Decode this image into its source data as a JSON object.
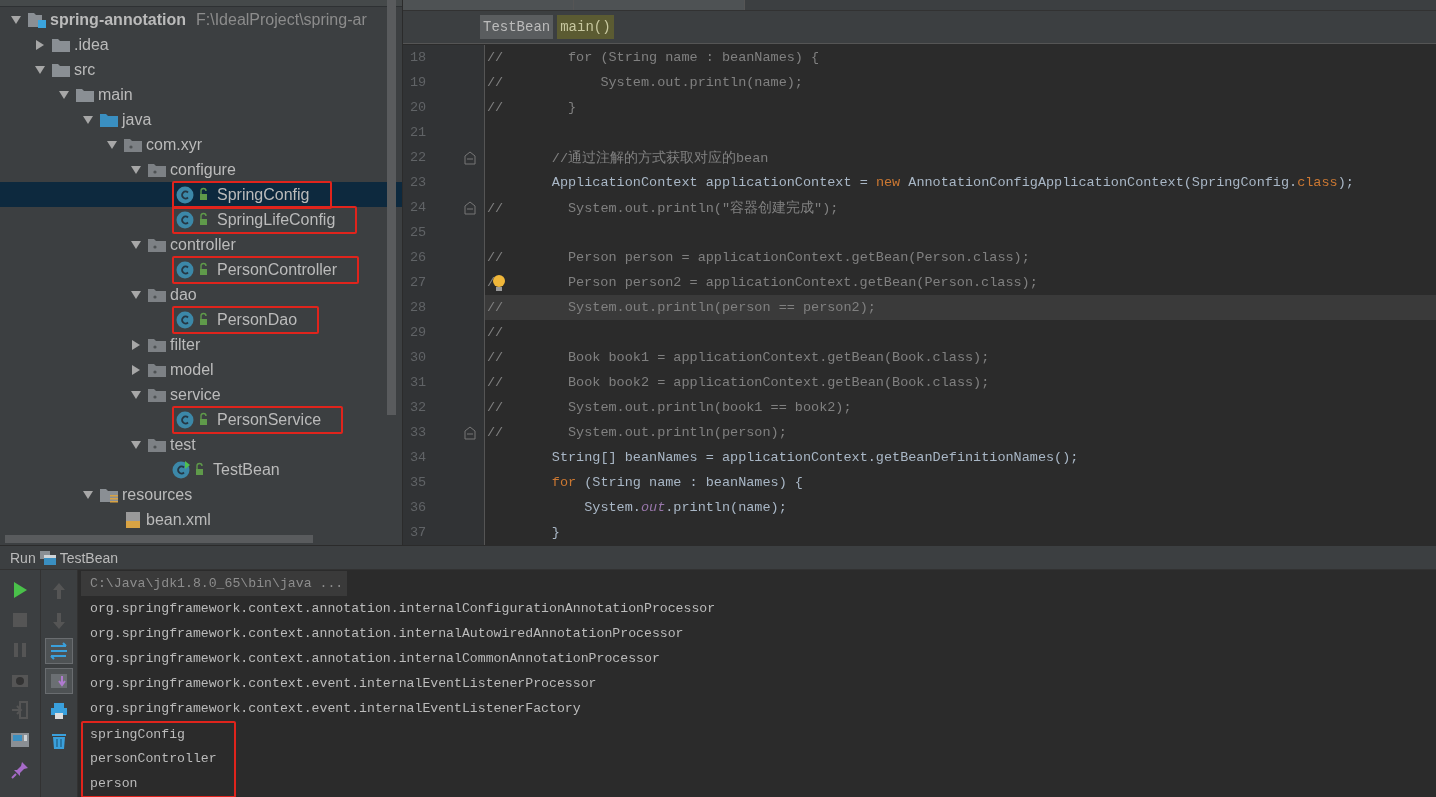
{
  "project_tree": {
    "items": [
      {
        "label": "spring-annotation",
        "kind": "project",
        "path": "F:\\IdealProject\\spring-ar",
        "expanded": true,
        "selected": false,
        "boxed": false,
        "children": [
          {
            "label": ".idea",
            "kind": "folder",
            "expanded": false,
            "selected": false,
            "boxed": false
          },
          {
            "label": "src",
            "kind": "folder",
            "expanded": true,
            "selected": false,
            "boxed": false,
            "children": [
              {
                "label": "main",
                "kind": "folder",
                "expanded": true,
                "selected": false,
                "boxed": false,
                "children": [
                  {
                    "label": "java",
                    "kind": "source",
                    "expanded": true,
                    "selected": false,
                    "boxed": false,
                    "children": [
                      {
                        "label": "com.xyr",
                        "kind": "package",
                        "expanded": true,
                        "selected": false,
                        "boxed": false,
                        "children": [
                          {
                            "label": "configure",
                            "kind": "package",
                            "expanded": true,
                            "selected": false,
                            "boxed": false,
                            "children": [
                              {
                                "label": "SpringConfig",
                                "kind": "class",
                                "selected": true,
                                "boxed": true
                              },
                              {
                                "label": "SpringLifeConfig",
                                "kind": "class",
                                "selected": false,
                                "boxed": true
                              }
                            ]
                          },
                          {
                            "label": "controller",
                            "kind": "package",
                            "expanded": true,
                            "selected": false,
                            "boxed": false,
                            "children": [
                              {
                                "label": "PersonController",
                                "kind": "class",
                                "selected": false,
                                "boxed": true
                              }
                            ]
                          },
                          {
                            "label": "dao",
                            "kind": "package",
                            "expanded": true,
                            "selected": false,
                            "boxed": false,
                            "children": [
                              {
                                "label": "PersonDao",
                                "kind": "class",
                                "selected": false,
                                "boxed": true
                              }
                            ]
                          },
                          {
                            "label": "filter",
                            "kind": "package",
                            "expanded": false,
                            "selected": false,
                            "boxed": false
                          },
                          {
                            "label": "model",
                            "kind": "package",
                            "expanded": false,
                            "selected": false,
                            "boxed": false
                          },
                          {
                            "label": "service",
                            "kind": "package",
                            "expanded": true,
                            "selected": false,
                            "boxed": false,
                            "children": [
                              {
                                "label": "PersonService",
                                "kind": "class",
                                "selected": false,
                                "boxed": true
                              }
                            ]
                          },
                          {
                            "label": "test",
                            "kind": "package",
                            "expanded": true,
                            "selected": false,
                            "boxed": false,
                            "children": [
                              {
                                "label": "TestBean",
                                "kind": "runnable",
                                "selected": false,
                                "boxed": false
                              }
                            ]
                          }
                        ]
                      }
                    ]
                  },
                  {
                    "label": "resources",
                    "kind": "resources",
                    "expanded": true,
                    "selected": false,
                    "boxed": false,
                    "children": [
                      {
                        "label": "bean.xml",
                        "kind": "xml",
                        "selected": false,
                        "boxed": false
                      }
                    ]
                  }
                ]
              }
            ]
          }
        ]
      }
    ]
  },
  "editor": {
    "breadcrumbs": [
      {
        "label": "TestBean",
        "selected": false
      },
      {
        "label": "main()",
        "selected": true
      }
    ],
    "lines": [
      {
        "number": "18",
        "current": false,
        "segments": [
          {
            "text": "//        for (String name : beanNames) {",
            "kind": "comment"
          }
        ]
      },
      {
        "number": "19",
        "current": false,
        "segments": [
          {
            "text": "//            System.out.println(name);",
            "kind": "comment"
          }
        ]
      },
      {
        "number": "20",
        "current": false,
        "segments": [
          {
            "text": "//        }",
            "kind": "comment"
          }
        ]
      },
      {
        "number": "21",
        "current": false
      },
      {
        "number": "22",
        "current": false,
        "fold_marker": true,
        "segments": [
          {
            "text": "        //通过注解的方式获取对应的bean",
            "kind": "comment"
          }
        ]
      },
      {
        "number": "23",
        "current": false,
        "segments": [
          {
            "text": "        ApplicationContext applicationContext = ",
            "kind": "plain"
          },
          {
            "text": "new",
            "kind": "keyword"
          },
          {
            "text": " AnnotationConfigApplicationContext(SpringConfig.",
            "kind": "plain"
          },
          {
            "text": "class",
            "kind": "keyword"
          },
          {
            "text": ");",
            "kind": "plain"
          }
        ]
      },
      {
        "number": "24",
        "current": false,
        "fold_marker": true,
        "segments": [
          {
            "text": "//        System.out.println(\"容器创建完成\");",
            "kind": "comment"
          }
        ]
      },
      {
        "number": "25",
        "current": false
      },
      {
        "number": "26",
        "current": false,
        "segments": [
          {
            "text": "//        Person person = applicationContext.getBean(Person.class);",
            "kind": "comment"
          }
        ]
      },
      {
        "number": "27",
        "current": false,
        "segments": [
          {
            "text": "/",
            "kind": "comment"
          },
          {
            "kind": "bulb"
          },
          {
            "text": "        Person person2 = applicationContext.getBean(Person.class);",
            "kind": "comment"
          }
        ]
      },
      {
        "number": "28",
        "current": true,
        "segments": [
          {
            "text": "//        System.out.println(person == person2);",
            "kind": "comment"
          }
        ]
      },
      {
        "number": "29",
        "current": false,
        "segments": [
          {
            "text": "//",
            "kind": "comment"
          }
        ]
      },
      {
        "number": "30",
        "current": false,
        "segments": [
          {
            "text": "//        Book book1 = applicationContext.getBean(Book.class);",
            "kind": "comment"
          }
        ]
      },
      {
        "number": "31",
        "current": false,
        "segments": [
          {
            "text": "//        Book book2 = applicationContext.getBean(Book.class);",
            "kind": "comment"
          }
        ]
      },
      {
        "number": "32",
        "current": false,
        "segments": [
          {
            "text": "//        System.out.println(book1 == book2);",
            "kind": "comment"
          }
        ]
      },
      {
        "number": "33",
        "current": false,
        "fold_marker": true,
        "segments": [
          {
            "text": "//        System.out.println(person);",
            "kind": "comment"
          }
        ]
      },
      {
        "number": "34",
        "current": false,
        "segments": [
          {
            "text": "        String[] beanNames = applicationContext.getBeanDefinitionNames();",
            "kind": "plain"
          }
        ]
      },
      {
        "number": "35",
        "current": false,
        "segments": [
          {
            "text": "        for",
            "kind": "keyword"
          },
          {
            "text": " (String name : beanNames) {",
            "kind": "plain"
          }
        ]
      },
      {
        "number": "36",
        "current": false,
        "segments": [
          {
            "text": "            System.",
            "kind": "plain"
          },
          {
            "text": "out",
            "kind": "field"
          },
          {
            "text": ".println(name);",
            "kind": "plain"
          }
        ]
      },
      {
        "number": "37",
        "current": false,
        "segments": [
          {
            "text": "        }",
            "kind": "plain"
          }
        ]
      }
    ]
  },
  "run_panel": {
    "title": "Run",
    "config": "TestBean",
    "toolbar_left": [
      {
        "kind": "run"
      },
      {
        "kind": "stop"
      },
      {
        "kind": "pause"
      },
      {
        "kind": "dump"
      },
      {
        "kind": "exit"
      },
      {
        "kind": "layout"
      },
      {
        "kind": "pin"
      }
    ],
    "toolbar_right": [
      {
        "kind": "up",
        "selected": false
      },
      {
        "kind": "down",
        "selected": false
      },
      {
        "kind": "wrap",
        "selected": true
      },
      {
        "kind": "scroll",
        "selected": true
      },
      {
        "kind": "print",
        "selected": false
      },
      {
        "kind": "trash",
        "selected": false
      }
    ],
    "console": [
      {
        "text": "C:\\Java\\jdk1.8.0_65\\bin\\java ...",
        "kind": "command",
        "boxed": false
      },
      {
        "text": "org.springframework.context.annotation.internalConfigurationAnnotationProcessor",
        "kind": "output",
        "boxed": false
      },
      {
        "text": "org.springframework.context.annotation.internalAutowiredAnnotationProcessor",
        "kind": "output",
        "boxed": false
      },
      {
        "text": "org.springframework.context.annotation.internalCommonAnnotationProcessor",
        "kind": "output",
        "boxed": false
      },
      {
        "text": "org.springframework.context.event.internalEventListenerProcessor",
        "kind": "output",
        "boxed": false
      },
      {
        "text": "org.springframework.context.event.internalEventListenerFactory",
        "kind": "output",
        "boxed": false
      },
      {
        "text": "springConfig",
        "kind": "output",
        "boxed": true
      },
      {
        "text": "personController",
        "kind": "output",
        "boxed": true
      },
      {
        "text": "person",
        "kind": "output",
        "boxed": true
      }
    ]
  }
}
